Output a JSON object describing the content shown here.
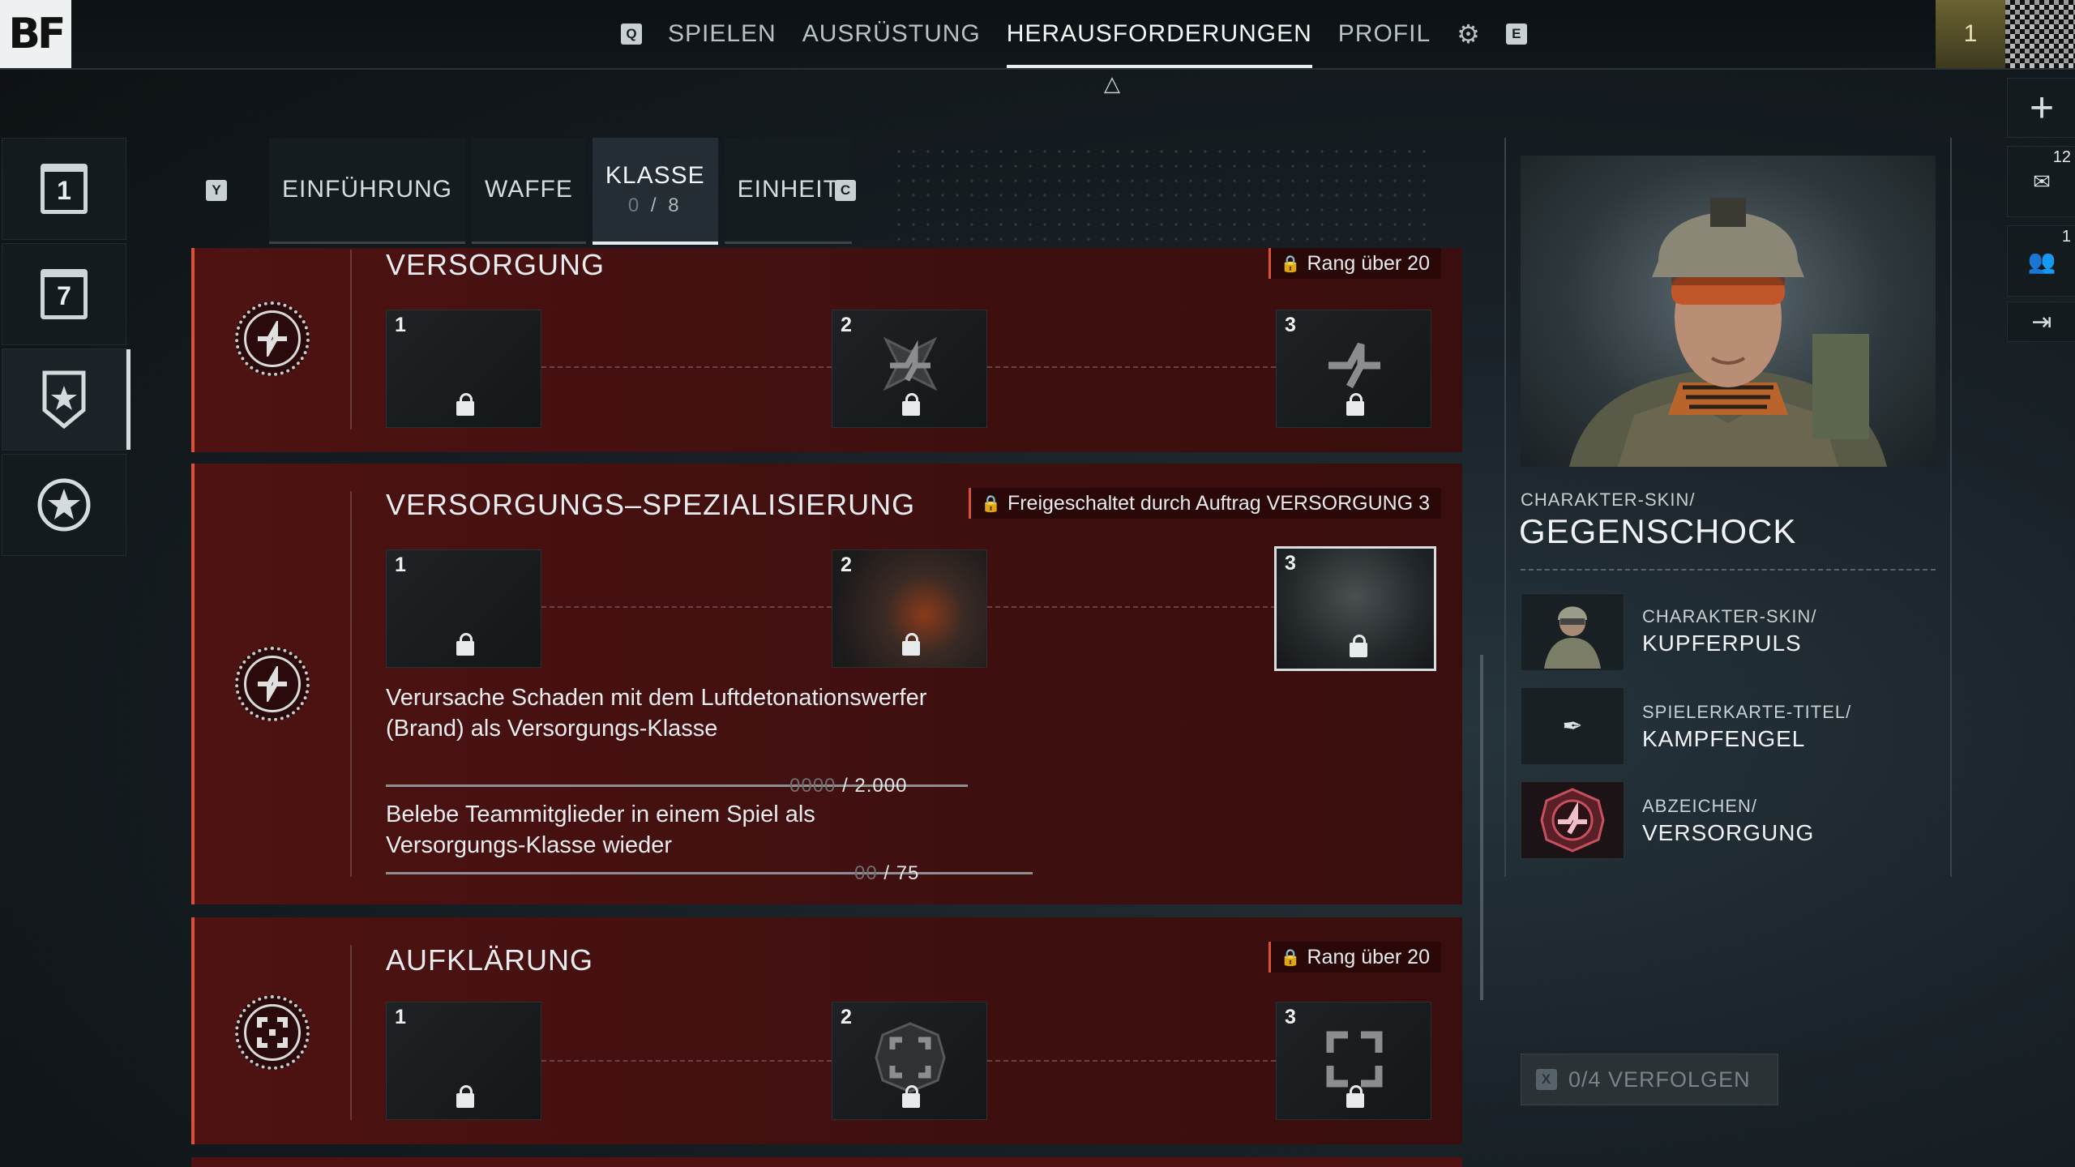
{
  "app": {
    "logo": "BF",
    "rank_level": "1"
  },
  "nav": {
    "key_left": "Q",
    "items": [
      "SPIELEN",
      "AUSRÜSTUNG",
      "HERAUSFORDERUNGEN",
      "PROFIL"
    ],
    "active": "HERAUSFORDERUNGEN",
    "key_right": "E"
  },
  "right_icons": {
    "mail_count": "12",
    "squad_count": "1"
  },
  "sidebar": {
    "daily_label": "1",
    "weekly_label": "7"
  },
  "tabs": {
    "key_left": "Y",
    "key_right": "C",
    "items": [
      {
        "label": "EINFÜHRUNG"
      },
      {
        "label": "WAFFE"
      },
      {
        "label": "KLASSE",
        "progress_done": "0",
        "progress_sep": " / ",
        "progress_total": "8"
      },
      {
        "label": "EINHEIT"
      }
    ]
  },
  "sections": [
    {
      "title": "VERSORGUNG",
      "lock_text": "Rang über 20",
      "tiles": [
        "1",
        "2",
        "3"
      ]
    },
    {
      "title": "VERSORGUNGS–SPEZIALISIERUNG",
      "lock_text": "Freigeschaltet durch Auftrag VERSORGUNG 3",
      "tiles": [
        "1",
        "2",
        "3"
      ],
      "challenges": [
        {
          "text": "Verursache Schaden mit dem Luftdetonationswerfer (Brand) als Versorgungs-Klasse",
          "progress_zeros": "0000",
          "progress_total": "/ 2.000",
          "progress": 0
        },
        {
          "text": "Belebe Teammitglieder in einem Spiel als Versorgungs-Klasse wieder",
          "progress_zeros": "00",
          "progress_total": "/ 75",
          "progress": 0
        }
      ]
    },
    {
      "title": "AUFKLÄRUNG",
      "lock_text": "Rang über 20",
      "tiles": [
        "1",
        "2",
        "3"
      ]
    }
  ],
  "reward_panel": {
    "main": {
      "category": "CHARAKTER-SKIN/",
      "name": "GEGENSCHOCK"
    },
    "items": [
      {
        "category": "CHARAKTER-SKIN/",
        "name": "KUPFERPULS"
      },
      {
        "category": "SPIELERKARTE-TITEL/",
        "name": "KAMPFENGEL"
      },
      {
        "category": "ABZEICHEN/",
        "name": "VERSORGUNG"
      }
    ]
  },
  "track_button": {
    "key": "X",
    "label": "0/4 VERFOLGEN"
  },
  "colors": {
    "section_bg": "#4e1212",
    "accent": "#d8523a"
  }
}
